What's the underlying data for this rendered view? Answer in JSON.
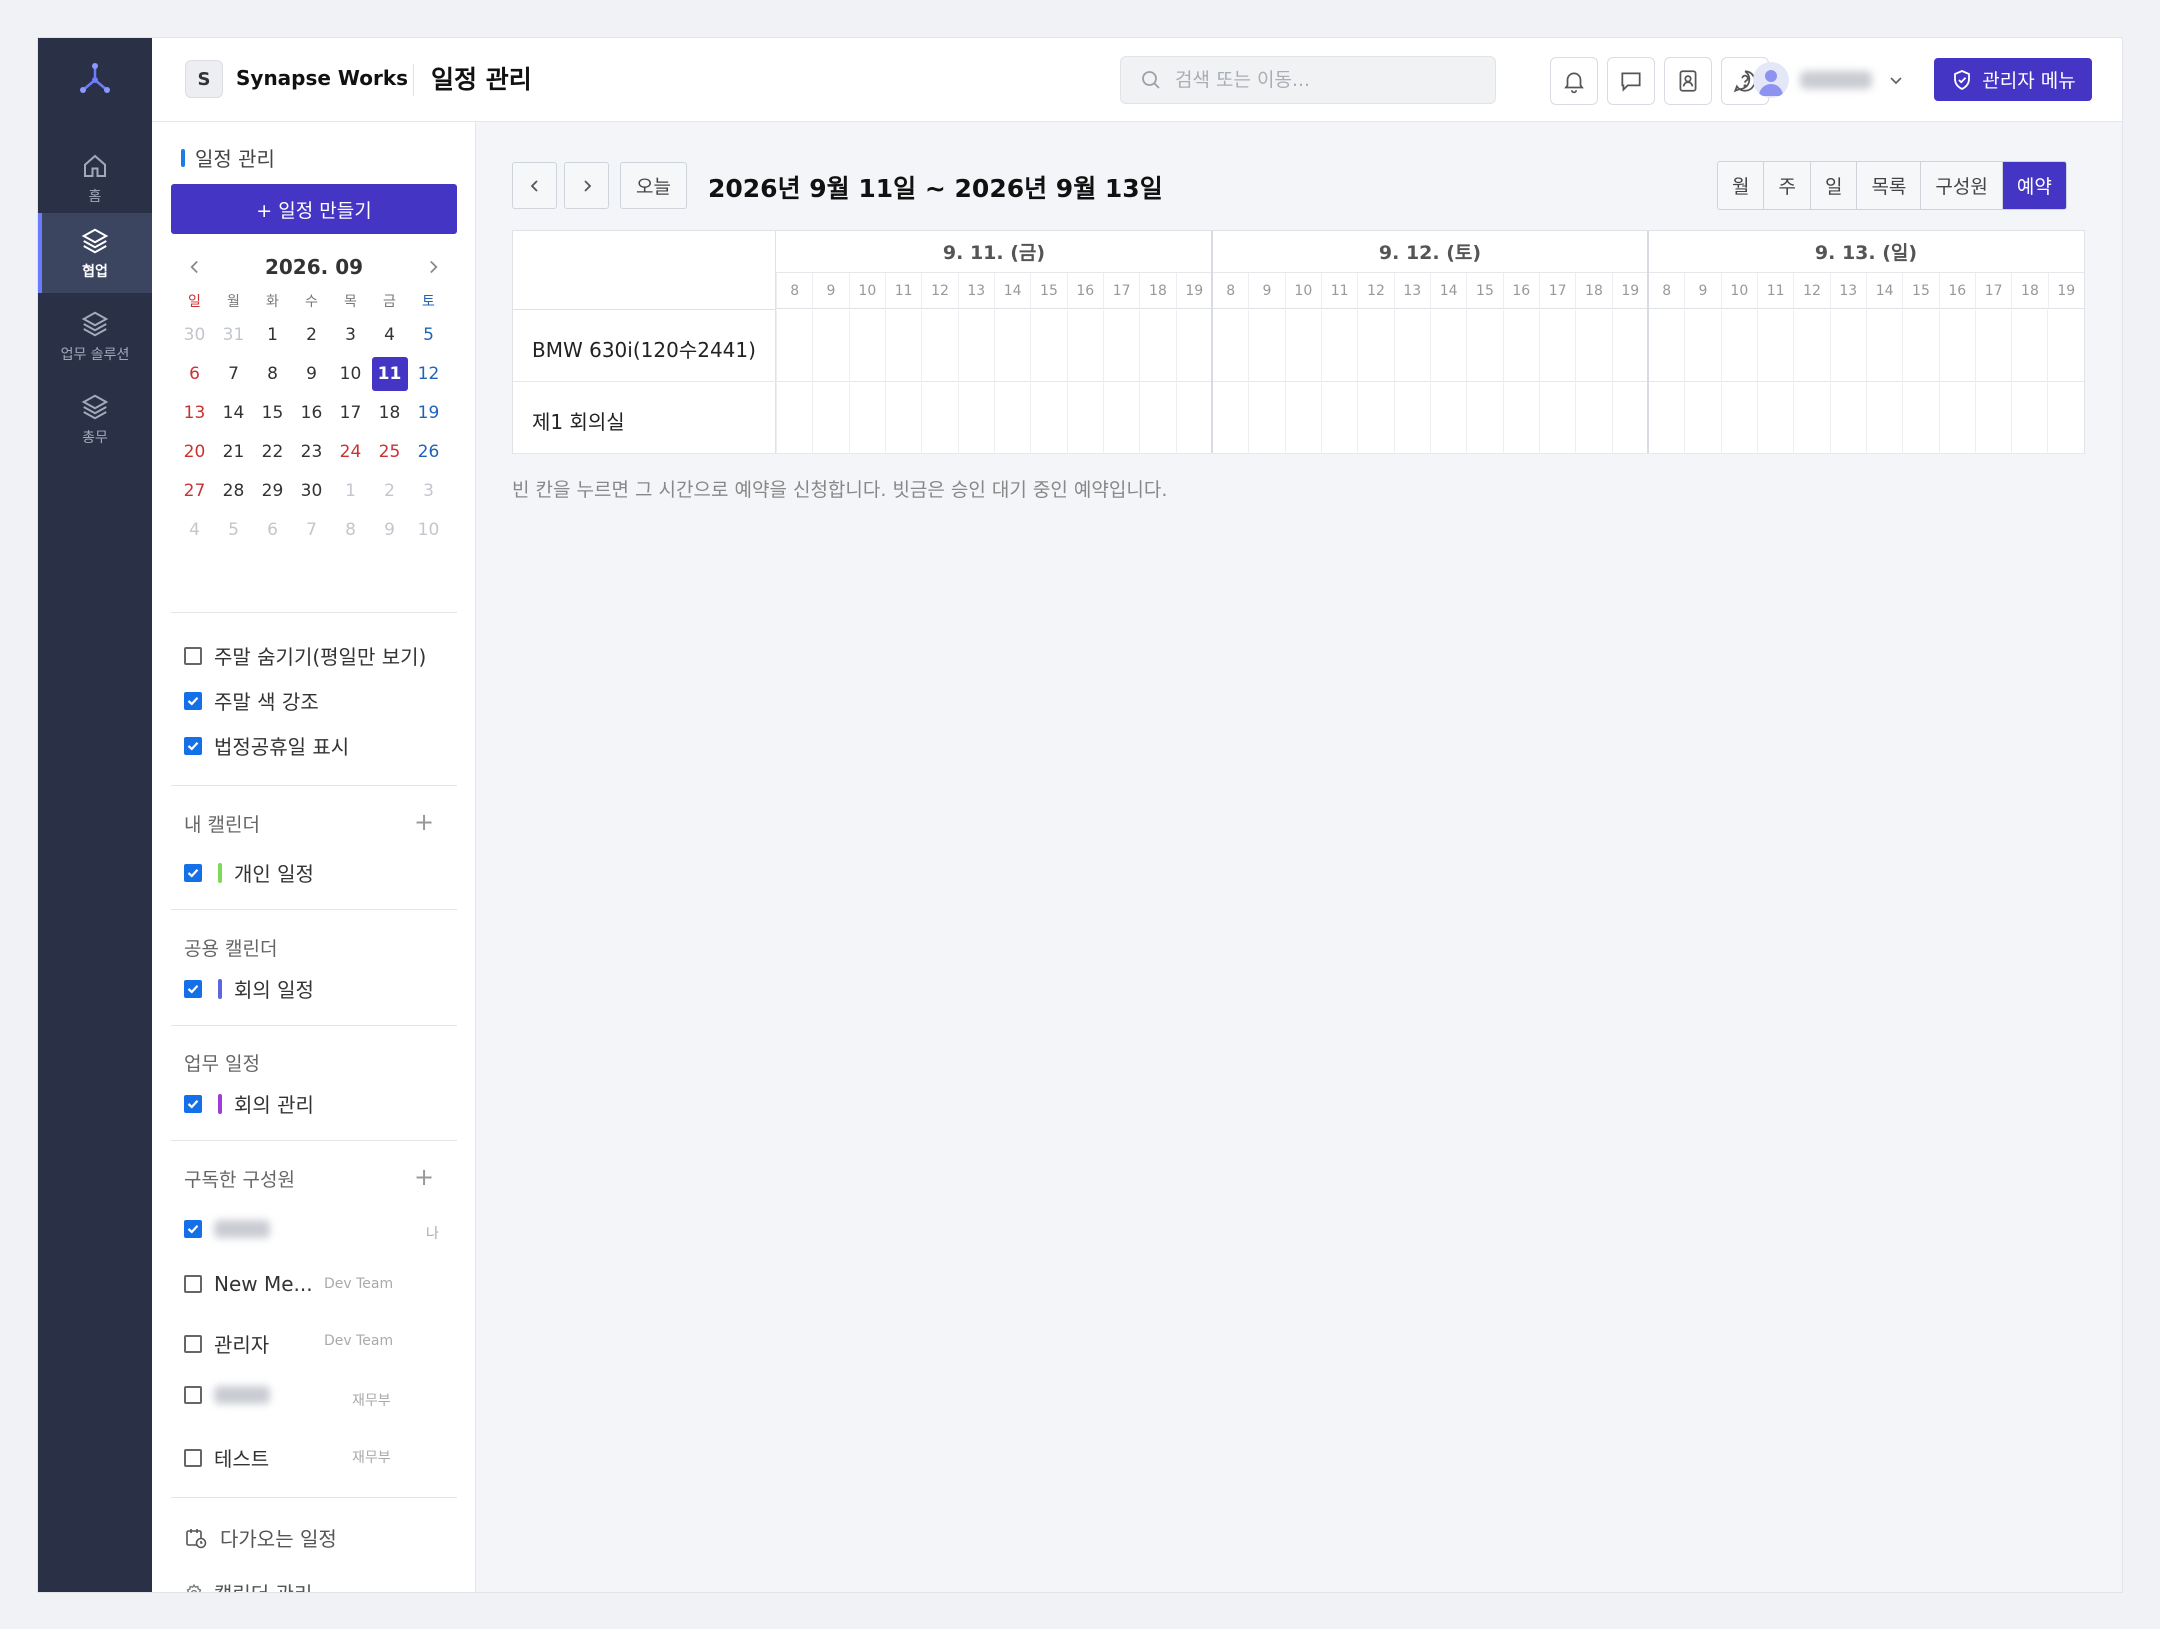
{
  "workspace": {
    "badge": "S",
    "name": "Synapse Works"
  },
  "header": {
    "title": "일정 관리",
    "search_placeholder": "검색 또는 이동...",
    "admin_button": "관리자 메뉴"
  },
  "rail": {
    "items": [
      {
        "label": "홈",
        "icon": "home-icon"
      },
      {
        "label": "협업",
        "icon": "layers-icon",
        "active": true
      },
      {
        "label": "업무 솔루션",
        "icon": "layers-icon"
      },
      {
        "label": "총무",
        "icon": "layers-icon"
      }
    ]
  },
  "sidebar": {
    "title": "일정 관리",
    "create_button": "+ 일정 만들기",
    "mini_calendar": {
      "month_label": "2026. 09",
      "weekdays": [
        "일",
        "월",
        "화",
        "수",
        "목",
        "금",
        "토"
      ],
      "weeks": [
        [
          "30",
          "31",
          "1",
          "2",
          "3",
          "4",
          "5"
        ],
        [
          "6",
          "7",
          "8",
          "9",
          "10",
          "11",
          "12"
        ],
        [
          "13",
          "14",
          "15",
          "16",
          "17",
          "18",
          "19"
        ],
        [
          "20",
          "21",
          "22",
          "23",
          "24",
          "25",
          "26"
        ],
        [
          "27",
          "28",
          "29",
          "30",
          "1",
          "2",
          "3"
        ],
        [
          "4",
          "5",
          "6",
          "7",
          "8",
          "9",
          "10"
        ]
      ],
      "today": "11"
    },
    "options": [
      {
        "label": "주말 숨기기(평일만 보기)",
        "checked": false
      },
      {
        "label": "주말 색 강조",
        "checked": true
      },
      {
        "label": "법정공휴일 표시",
        "checked": true
      }
    ],
    "my_calendars": {
      "title": "내 캘린더",
      "items": [
        {
          "label": "개인 일정",
          "color": "#7ed957",
          "checked": true
        }
      ]
    },
    "shared_calendars": {
      "title": "공용 캘린더",
      "items": [
        {
          "label": "회의 일정",
          "color": "#5b66e0",
          "checked": true
        }
      ]
    },
    "work_calendars": {
      "title": "업무 일정",
      "items": [
        {
          "label": "회의 관리",
          "color": "#9b3fd6",
          "checked": true
        }
      ]
    },
    "subscribed": {
      "title": "구독한 구성원",
      "items": [
        {
          "label": "",
          "team": "나",
          "checked": true,
          "blurred": true
        },
        {
          "label": "New Me...",
          "team": "Dev Team",
          "checked": false
        },
        {
          "label": "관리자",
          "team": "Dev Team",
          "checked": false
        },
        {
          "label": "",
          "team": "재무부",
          "checked": false,
          "blurred": true
        },
        {
          "label": "테스트",
          "team": "재무부",
          "checked": false
        }
      ]
    },
    "footer": {
      "upcoming": "다가오는 일정",
      "manage": "캘린더 관리"
    }
  },
  "toolbar": {
    "today_button": "오늘",
    "range_title": "2026년 9월 11일 ~ 2026년 9월 13일",
    "views": [
      "월",
      "주",
      "일",
      "목록",
      "구성원",
      "예약"
    ],
    "active_view": "예약"
  },
  "reservation": {
    "days": [
      "9. 11. (금)",
      "9. 12. (토)",
      "9. 13. (일)"
    ],
    "hours": [
      "8",
      "9",
      "10",
      "11",
      "12",
      "13",
      "14",
      "15",
      "16",
      "17",
      "18",
      "19"
    ],
    "resources": [
      "BMW 630i(120수2441)",
      "제1 회의실"
    ],
    "hint": "빈 칸을 누르면 그 시간으로 예약을 신청합니다. 빗금은 승인 대기 중인 예약입니다."
  }
}
